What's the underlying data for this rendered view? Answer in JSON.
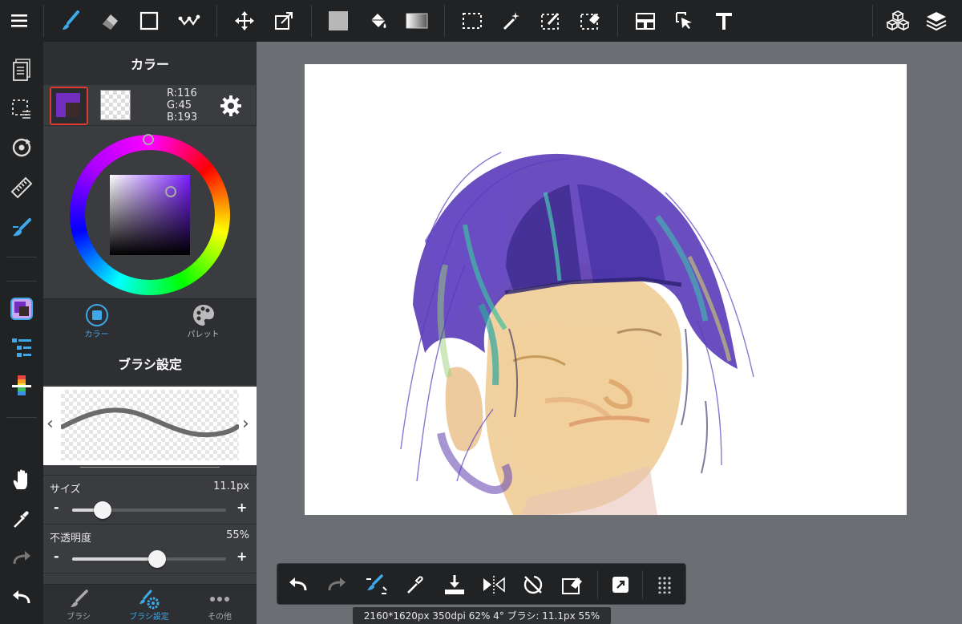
{
  "colors": {
    "accent": "#3fa8e8",
    "current_color": "#742dc1",
    "selected_border": "#e03a2e"
  },
  "top_toolbar": {
    "menu_icon": "hamburger-icon",
    "tools": [
      "brush-icon",
      "eraser-icon",
      "rectangle-icon",
      "correction-icon",
      "move-icon",
      "transform-icon",
      "fill-color-icon",
      "bucket-icon",
      "gradient-icon",
      "select-rect-icon",
      "magic-wand-icon",
      "select-pen-icon",
      "select-eraser-icon",
      "frame-icon",
      "operation-icon",
      "text-icon"
    ],
    "right_tools": [
      "material-icon",
      "layers-icon"
    ]
  },
  "rail": [
    "pages-icon",
    "selection-icon",
    "rotate-icon",
    "ruler-icon",
    "brush-tool-icon",
    "color-icon",
    "brush-list-icon",
    "palette-bar-icon",
    "hand-icon",
    "eyedropper-icon",
    "redo-icon",
    "undo-icon"
  ],
  "color_panel": {
    "title": "カラー",
    "r": "R:116",
    "g": "G:45",
    "b": "B:193",
    "tabs": [
      {
        "label": "カラー"
      },
      {
        "label": "パレット"
      }
    ]
  },
  "brush_panel": {
    "title": "ブラシ設定",
    "size": {
      "label": "サイズ",
      "value": "11.1px",
      "minus": "-",
      "plus": "+",
      "level": 0.2
    },
    "opacity": {
      "label": "不透明度",
      "value": "55%",
      "minus": "-",
      "plus": "+",
      "level": 0.55
    },
    "bottom_tabs": [
      {
        "label": "ブラシ"
      },
      {
        "label": "ブラシ設定"
      },
      {
        "label": "その他"
      }
    ]
  },
  "float_toolbar": [
    "undo-icon",
    "redo-icon",
    "brush-snap-icon",
    "eyedropper-icon",
    "save-icon",
    "flip-icon",
    "rotate-reset-icon",
    "clear-icon",
    "export-icon",
    "grid-icon"
  ],
  "status_text": "2160*1620px 350dpi 62% 4° ブラシ: 11.1px 55%"
}
